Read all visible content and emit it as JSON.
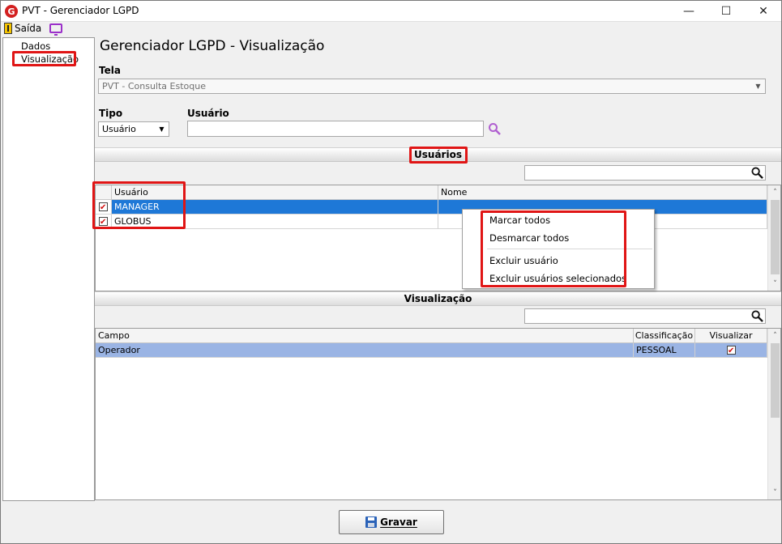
{
  "window": {
    "title": "PVT - Gerenciador LGPD",
    "minimize": "—",
    "maximize": "☐",
    "close": "✕"
  },
  "toolbar": {
    "exit_label": "Saída"
  },
  "tree": {
    "items": [
      {
        "label": "Dados"
      },
      {
        "label": "Visualização"
      }
    ]
  },
  "main": {
    "title": "Gerenciador LGPD - Visualização",
    "tela_label": "Tela",
    "tela_value": "PVT - Consulta Estoque",
    "tipo_label": "Tipo",
    "tipo_value": "Usuário",
    "usuario_label": "Usuário",
    "usuario_value": ""
  },
  "users_section": {
    "title": "Usuários",
    "search_value": "",
    "columns": [
      "Usuário",
      "Nome"
    ],
    "rows": [
      {
        "usuario": "MANAGER",
        "nome": "",
        "checked": true,
        "selected": true
      },
      {
        "usuario": "GLOBUS",
        "nome": "",
        "checked": true,
        "selected": false
      }
    ]
  },
  "context_menu": {
    "items": [
      {
        "label": "Marcar todos"
      },
      {
        "label": "Desmarcar todos"
      },
      {
        "label": "Excluir usuário"
      },
      {
        "label": "Excluir usuários selecionados"
      }
    ]
  },
  "view_section": {
    "title": "Visualização",
    "search_value": "",
    "columns": [
      "Campo",
      "Classificação",
      "Visualizar"
    ],
    "rows": [
      {
        "campo": "Operador",
        "classificacao": "PESSOAL",
        "visualizar": true
      }
    ]
  },
  "footer": {
    "save_label": "Gravar"
  },
  "colors": {
    "accent_red": "#e01515",
    "selected_row": "#1e78d7",
    "selected_row_light": "#9ab4e4",
    "search_icon": "#b05fd0"
  }
}
